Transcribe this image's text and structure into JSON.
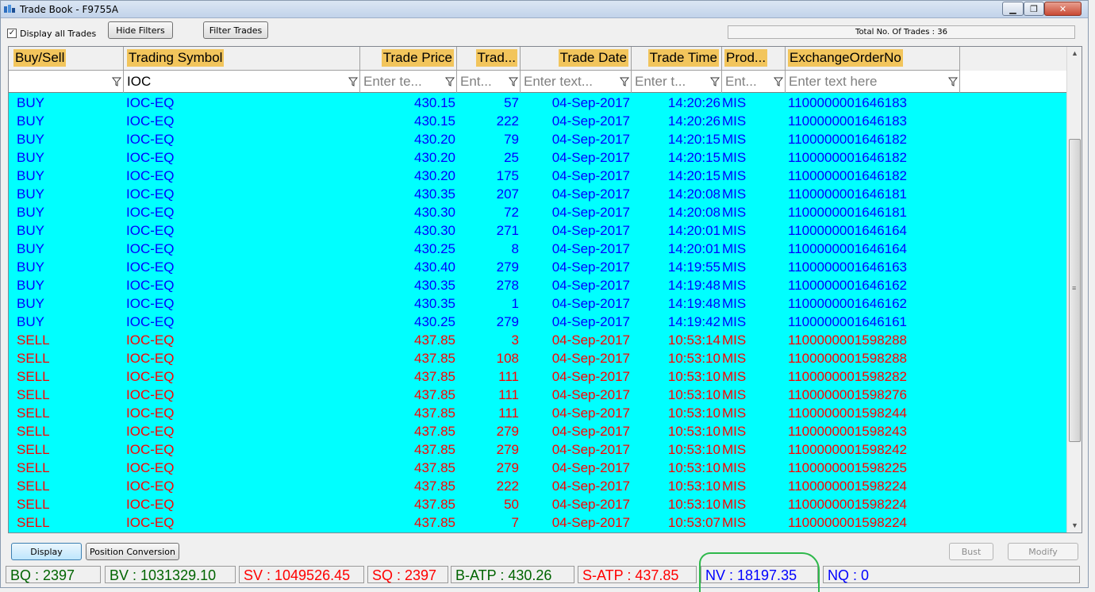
{
  "window": {
    "title": "Trade Book - F9755A"
  },
  "toolbar": {
    "display_all_label": "Display all Trades",
    "display_all_checked": "✓",
    "hide_filters_label": "Hide Filters",
    "filter_trades_label": "Filter Trades",
    "total_trades": "Total No. Of Trades : 36"
  },
  "grid": {
    "headers": [
      "Buy/Sell",
      "Trading Symbol",
      "Trade Price",
      "Trad...",
      "Trade Date",
      "Trade Time",
      "Prod...",
      "ExchangeOrderNo"
    ],
    "filters": {
      "buy_sell": "",
      "symbol": "IOC",
      "price": "Enter te...",
      "qty": "Ent...",
      "date": "Enter text...",
      "time": "Enter t...",
      "product": "Ent...",
      "exch": "Enter text here"
    },
    "rows": [
      [
        "BUY",
        "IOC-EQ",
        "430.15",
        "57",
        "04-Sep-2017",
        "14:20:26",
        "MIS",
        "1100000001646183"
      ],
      [
        "BUY",
        "IOC-EQ",
        "430.15",
        "222",
        "04-Sep-2017",
        "14:20:26",
        "MIS",
        "1100000001646183"
      ],
      [
        "BUY",
        "IOC-EQ",
        "430.20",
        "79",
        "04-Sep-2017",
        "14:20:15",
        "MIS",
        "1100000001646182"
      ],
      [
        "BUY",
        "IOC-EQ",
        "430.20",
        "25",
        "04-Sep-2017",
        "14:20:15",
        "MIS",
        "1100000001646182"
      ],
      [
        "BUY",
        "IOC-EQ",
        "430.20",
        "175",
        "04-Sep-2017",
        "14:20:15",
        "MIS",
        "1100000001646182"
      ],
      [
        "BUY",
        "IOC-EQ",
        "430.35",
        "207",
        "04-Sep-2017",
        "14:20:08",
        "MIS",
        "1100000001646181"
      ],
      [
        "BUY",
        "IOC-EQ",
        "430.30",
        "72",
        "04-Sep-2017",
        "14:20:08",
        "MIS",
        "1100000001646181"
      ],
      [
        "BUY",
        "IOC-EQ",
        "430.30",
        "271",
        "04-Sep-2017",
        "14:20:01",
        "MIS",
        "1100000001646164"
      ],
      [
        "BUY",
        "IOC-EQ",
        "430.25",
        "8",
        "04-Sep-2017",
        "14:20:01",
        "MIS",
        "1100000001646164"
      ],
      [
        "BUY",
        "IOC-EQ",
        "430.40",
        "279",
        "04-Sep-2017",
        "14:19:55",
        "MIS",
        "1100000001646163"
      ],
      [
        "BUY",
        "IOC-EQ",
        "430.35",
        "278",
        "04-Sep-2017",
        "14:19:48",
        "MIS",
        "1100000001646162"
      ],
      [
        "BUY",
        "IOC-EQ",
        "430.35",
        "1",
        "04-Sep-2017",
        "14:19:48",
        "MIS",
        "1100000001646162"
      ],
      [
        "BUY",
        "IOC-EQ",
        "430.25",
        "279",
        "04-Sep-2017",
        "14:19:42",
        "MIS",
        "1100000001646161"
      ],
      [
        "SELL",
        "IOC-EQ",
        "437.85",
        "3",
        "04-Sep-2017",
        "10:53:14",
        "MIS",
        "1100000001598288"
      ],
      [
        "SELL",
        "IOC-EQ",
        "437.85",
        "108",
        "04-Sep-2017",
        "10:53:10",
        "MIS",
        "1100000001598288"
      ],
      [
        "SELL",
        "IOC-EQ",
        "437.85",
        "111",
        "04-Sep-2017",
        "10:53:10",
        "MIS",
        "1100000001598282"
      ],
      [
        "SELL",
        "IOC-EQ",
        "437.85",
        "111",
        "04-Sep-2017",
        "10:53:10",
        "MIS",
        "1100000001598276"
      ],
      [
        "SELL",
        "IOC-EQ",
        "437.85",
        "111",
        "04-Sep-2017",
        "10:53:10",
        "MIS",
        "1100000001598244"
      ],
      [
        "SELL",
        "IOC-EQ",
        "437.85",
        "279",
        "04-Sep-2017",
        "10:53:10",
        "MIS",
        "1100000001598243"
      ],
      [
        "SELL",
        "IOC-EQ",
        "437.85",
        "279",
        "04-Sep-2017",
        "10:53:10",
        "MIS",
        "1100000001598242"
      ],
      [
        "SELL",
        "IOC-EQ",
        "437.85",
        "279",
        "04-Sep-2017",
        "10:53:10",
        "MIS",
        "1100000001598225"
      ],
      [
        "SELL",
        "IOC-EQ",
        "437.85",
        "222",
        "04-Sep-2017",
        "10:53:10",
        "MIS",
        "1100000001598224"
      ],
      [
        "SELL",
        "IOC-EQ",
        "437.85",
        "50",
        "04-Sep-2017",
        "10:53:10",
        "MIS",
        "1100000001598224"
      ],
      [
        "SELL",
        "IOC-EQ",
        "437.85",
        "7",
        "04-Sep-2017",
        "10:53:07",
        "MIS",
        "1100000001598224"
      ]
    ]
  },
  "footer": {
    "display_label": "Display",
    "position_conversion_label": "Position Conversion",
    "bust_label": "Bust",
    "modify_label": "Modify"
  },
  "status": {
    "bq": "BQ : 2397",
    "bv": "BV : 1031329.10",
    "sv": "SV : 1049526.45",
    "sq": "SQ : 2397",
    "batp": "B-ATP : 430.26",
    "satp": "S-ATP : 437.85",
    "nv": "NV : 18197.35",
    "nq": "NQ : 0"
  },
  "colors": {
    "grid_background": "#00ffff",
    "buy_text": "#0000ff",
    "sell_text": "#ff0000",
    "header_highlight": "#f2c55c",
    "status_green": "#006400",
    "status_red": "#ff0000",
    "status_blue": "#0000ff",
    "annotation_circle": "#2eb84b"
  },
  "icons": {
    "app": "app-icon",
    "filter": "funnel-icon",
    "minimize": "minimize-icon",
    "maximize": "maximize-icon",
    "close": "close-icon"
  }
}
